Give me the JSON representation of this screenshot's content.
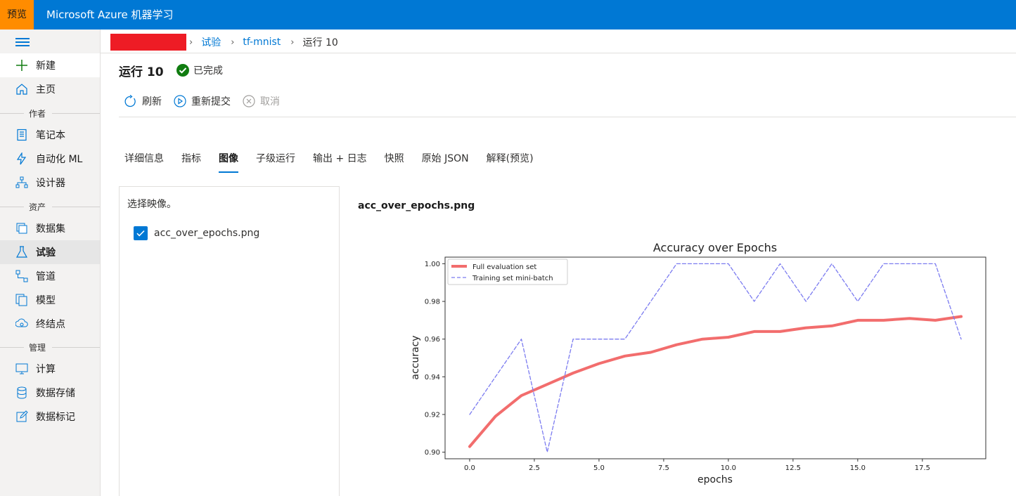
{
  "topbar": {
    "badge": "预览",
    "title": "Microsoft Azure 机器学习"
  },
  "nav": {
    "new": "新建",
    "home": "主页",
    "section_author": "作者",
    "notebooks": "笔记本",
    "automl": "自动化 ML",
    "designer": "设计器",
    "section_assets": "资产",
    "datasets": "数据集",
    "experiments": "试验",
    "pipelines": "管道",
    "models": "模型",
    "endpoints": "终结点",
    "section_manage": "管理",
    "compute": "计算",
    "datastores": "数据存储",
    "labeling": "数据标记"
  },
  "breadcrumb": {
    "experiments": "试验",
    "experiment": "tf-mnist",
    "run": "运行 10"
  },
  "header": {
    "title": "运行 10",
    "status": "已完成",
    "status_color": "#107c10"
  },
  "toolbar": {
    "refresh": "刷新",
    "resubmit": "重新提交",
    "cancel": "取消"
  },
  "tabs": [
    "详细信息",
    "指标",
    "图像",
    "子级运行",
    "输出 + 日志",
    "快照",
    "原始 JSON",
    "解释(预览)"
  ],
  "active_tab": "图像",
  "picker": {
    "prompt": "选择映像。",
    "items": [
      {
        "label": "acc_over_epochs.png",
        "checked": true
      }
    ]
  },
  "image_title": "acc_over_epochs.png",
  "chart_data": {
    "type": "line",
    "title": "Accuracy over Epochs",
    "xlabel": "epochs",
    "ylabel": "accuracy",
    "xlim": [
      -0.95,
      19.95
    ],
    "ylim": [
      0.8965,
      1.0035
    ],
    "xticks": [
      "0.0",
      "2.5",
      "5.0",
      "7.5",
      "10.0",
      "12.5",
      "15.0",
      "17.5"
    ],
    "xtick_values": [
      0,
      2.5,
      5,
      7.5,
      10,
      12.5,
      15,
      17.5
    ],
    "yticks": [
      "0.90",
      "0.92",
      "0.94",
      "0.96",
      "0.98",
      "1.00"
    ],
    "ytick_values": [
      0.9,
      0.92,
      0.94,
      0.96,
      0.98,
      1.0
    ],
    "legend_position": "top-left",
    "grid": false,
    "x": [
      0,
      1,
      2,
      3,
      4,
      5,
      6,
      7,
      8,
      9,
      10,
      11,
      12,
      13,
      14,
      15,
      16,
      17,
      18,
      19
    ],
    "series": [
      {
        "name": "Full evaluation set",
        "color": "#f26d6d",
        "style": "solid",
        "values": [
          0.903,
          0.919,
          0.93,
          0.936,
          0.942,
          0.947,
          0.951,
          0.953,
          0.957,
          0.96,
          0.961,
          0.964,
          0.964,
          0.966,
          0.967,
          0.97,
          0.97,
          0.971,
          0.97,
          0.972
        ]
      },
      {
        "name": "Training set mini-batch",
        "color": "#7b7bf0",
        "style": "dashed",
        "values": [
          0.92,
          0.94,
          0.96,
          0.9,
          0.96,
          0.96,
          0.96,
          0.98,
          1.0,
          1.0,
          1.0,
          0.98,
          1.0,
          0.98,
          1.0,
          0.98,
          1.0,
          1.0,
          1.0,
          0.96
        ]
      }
    ]
  }
}
